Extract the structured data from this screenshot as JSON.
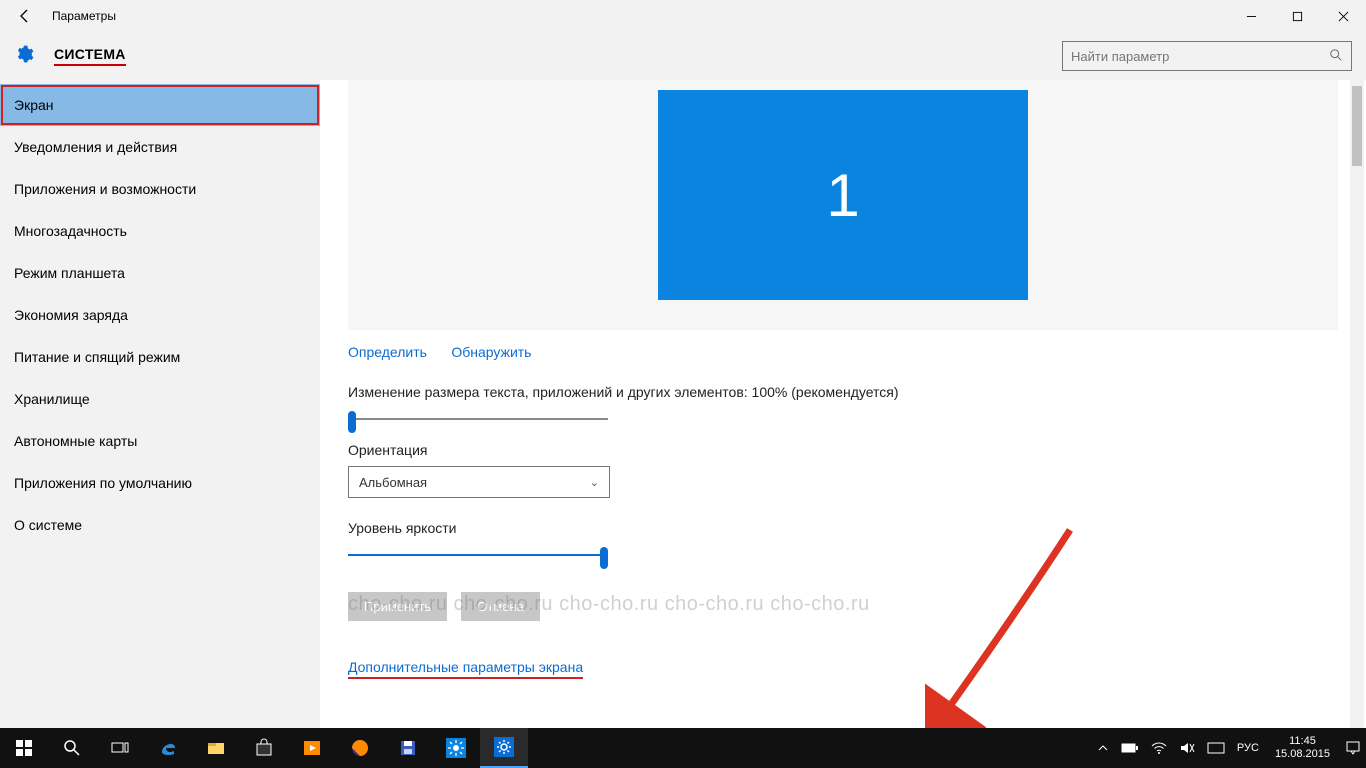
{
  "titlebar": {
    "title": "Параметры"
  },
  "header": {
    "category": "СИСТЕМА",
    "search_placeholder": "Найти параметр"
  },
  "sidebar": {
    "items": [
      "Экран",
      "Уведомления и действия",
      "Приложения и возможности",
      "Многозадачность",
      "Режим планшета",
      "Экономия заряда",
      "Питание и спящий режим",
      "Хранилище",
      "Автономные карты",
      "Приложения по умолчанию",
      "О системе"
    ],
    "active_index": 0
  },
  "display": {
    "monitor_number": "1",
    "identify": "Определить",
    "detect": "Обнаружить",
    "scale_label": "Изменение размера текста, приложений и других элементов: 100% (рекомендуется)",
    "orientation_label": "Ориентация",
    "orientation_value": "Альбомная",
    "brightness_label": "Уровень яркости",
    "apply_btn": "Применить",
    "cancel_btn": "Отмена",
    "advanced_link": "Дополнительные параметры экрана"
  },
  "watermark": "cho-cho.ru cho-cho.ru cho-cho.ru cho-cho.ru cho-cho.ru",
  "taskbar": {
    "lang": "РУС",
    "time": "11:45",
    "date": "15.08.2015"
  }
}
